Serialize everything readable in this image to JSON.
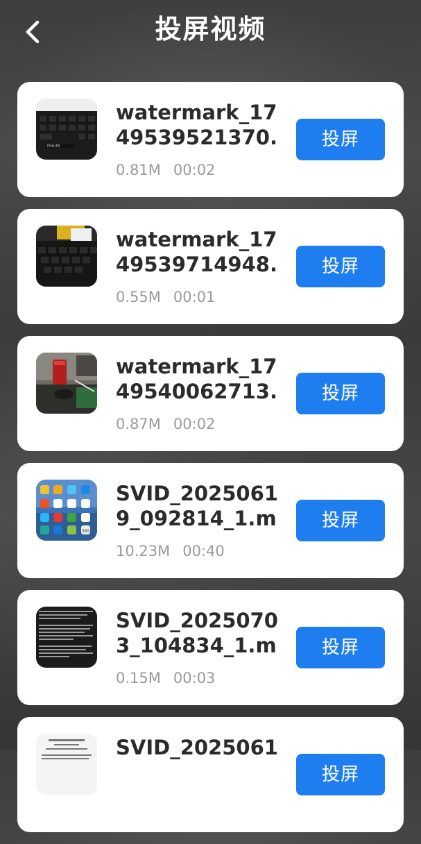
{
  "header": {
    "title": "投屏视频"
  },
  "videos": [
    {
      "name": "watermark_1749539521370.",
      "size": "0.81M",
      "duration": "00:02",
      "button": "投屏",
      "thumb": "keyboard-philips"
    },
    {
      "name": "watermark_1749539714948.",
      "size": "0.55M",
      "duration": "00:01",
      "button": "投屏",
      "thumb": "keyboard-desk"
    },
    {
      "name": "watermark_1749540062713.",
      "size": "0.87M",
      "duration": "00:02",
      "button": "投屏",
      "thumb": "desk-cup"
    },
    {
      "name": "SVID_20250619_092814_1.m",
      "size": "10.23M",
      "duration": "00:40",
      "button": "投屏",
      "thumb": "phone-homescreen"
    },
    {
      "name": "SVID_20250703_104834_1.m",
      "size": "0.15M",
      "duration": "00:03",
      "button": "投屏",
      "thumb": "text-document-dark"
    },
    {
      "name": "SVID_2025061",
      "size": "",
      "duration": "",
      "button": "投屏",
      "thumb": "text-document-light"
    }
  ],
  "colors": {
    "accent": "#1e7ef0",
    "card": "#ffffff",
    "meta_text": "#9a9a9a",
    "title_text": "#2b2b2b"
  }
}
